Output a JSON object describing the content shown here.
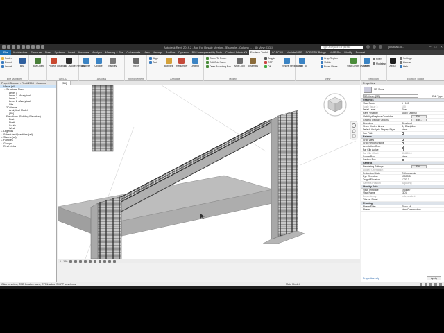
{
  "window": {
    "title": "Autodesk Revit 2019.2 - Not For Resale Version - [Example - Column ... - 3D View: {3D}]",
    "search_placeholder": "Type a keyword or phrase",
    "user": "jonathan.ho...",
    "controls": [
      "–",
      "□",
      "✕"
    ]
  },
  "ribbon_tabs": [
    {
      "label": "File"
    },
    {
      "label": "Architecture"
    },
    {
      "label": "Structure"
    },
    {
      "label": "Steel"
    },
    {
      "label": "Systems"
    },
    {
      "label": "Insert"
    },
    {
      "label": "Annotate"
    },
    {
      "label": "Analyze"
    },
    {
      "label": "Massing & Site"
    },
    {
      "label": "Collaborate"
    },
    {
      "label": "View"
    },
    {
      "label": "Manage"
    },
    {
      "label": "Add-Ins"
    },
    {
      "label": "Dynamo"
    },
    {
      "label": "BIM Interoperability Tools"
    },
    {
      "label": "Content Admin Kit"
    },
    {
      "label": "Ecotech Toolkit"
    },
    {
      "label": "AGACAD"
    },
    {
      "label": "Naviate MEP"
    },
    {
      "label": "SOFiSTiK Bridge"
    },
    {
      "label": "NMIP Pro"
    },
    {
      "label": "Modify"
    },
    {
      "label": "Precast"
    }
  ],
  "ribbon": {
    "groups": [
      {
        "title": "BIM Manager"
      },
      {
        "title": "QA/QC"
      },
      {
        "title": "Analysis"
      },
      {
        "title": "Reinforcement"
      },
      {
        "title": "Annotate"
      },
      {
        "title": "Modify"
      },
      {
        "title": "View"
      },
      {
        "title": "Selection"
      },
      {
        "title": "Ecotech Toolkit"
      }
    ],
    "buttons": {
      "folder": "Folder",
      "export": "Export",
      "import": "Import",
      "bim": "BIM",
      "bim_query": "BIM Query",
      "project_cleanup": "Project Cleanup",
      "qa_model_review": "QA - Model Review",
      "analyze": "Analyze",
      "update": "Update",
      "visibility": "Visibility",
      "rebar": "Rebar",
      "import2": "Import",
      "align": "Align",
      "text": "Text",
      "bubbles": "Bubbles",
      "renumber": "Renumber",
      "legend": "Legend",
      "room_to_room": "Room To Room",
      "edit_grid_name": "Edit Grid Name",
      "draw_bounding_box": "Draw Bounding Box",
      "multi_join": "Multi Join",
      "assembly": "Assembly",
      "toggle": "Toggle",
      "off": "OFF",
      "on": "ON",
      "resize_section_box": "Resize Section Box",
      "zoom_to": "Zoom To",
      "crop_region": "Crop Region",
      "visible": "Visible",
      "room_views": "Room Views",
      "view_depth_override": "View Depth Override",
      "select": "Select",
      "filter": "Filter",
      "modeless": "Modeless",
      "about": "About",
      "settings": "Settings",
      "license": "License",
      "help": "Help"
    }
  },
  "project_browser": {
    "title": "Project Browser - Revit 2019 - Columns",
    "items": [
      {
        "label": "Views (all)",
        "level": 0,
        "twisty": "−",
        "selected": true
      },
      {
        "label": "Structural Plans",
        "level": 1,
        "twisty": "−"
      },
      {
        "label": "Level 1",
        "level": 2,
        "twisty": ""
      },
      {
        "label": "Level 1 - Analytical",
        "level": 2,
        "twisty": ""
      },
      {
        "label": "Level 2",
        "level": 2,
        "twisty": ""
      },
      {
        "label": "Level 2 - Analytical",
        "level": 2,
        "twisty": ""
      },
      {
        "label": "Site",
        "level": 2,
        "twisty": ""
      },
      {
        "label": "3D Views",
        "level": 1,
        "twisty": "−"
      },
      {
        "label": "Analytical Model",
        "level": 2,
        "twisty": ""
      },
      {
        "label": "{3D}",
        "level": 2,
        "twisty": ""
      },
      {
        "label": "Elevations (Building Elevation)",
        "level": 1,
        "twisty": "−"
      },
      {
        "label": "East",
        "level": 2,
        "twisty": ""
      },
      {
        "label": "North",
        "level": 2,
        "twisty": ""
      },
      {
        "label": "South",
        "level": 2,
        "twisty": ""
      },
      {
        "label": "West",
        "level": 2,
        "twisty": ""
      },
      {
        "label": "Legends",
        "level": 0,
        "twisty": "+"
      },
      {
        "label": "Schedules/Quantities (all)",
        "level": 0,
        "twisty": "+"
      },
      {
        "label": "Sheets (all)",
        "level": 0,
        "twisty": "+"
      },
      {
        "label": "Families",
        "level": 0,
        "twisty": "+"
      },
      {
        "label": "Groups",
        "level": 0,
        "twisty": "+"
      },
      {
        "label": "Revit Links",
        "level": 0,
        "twisty": ""
      }
    ]
  },
  "view": {
    "tab_label": "{3D}",
    "scale": "1 : 100"
  },
  "properties": {
    "title": "Properties",
    "type_name": "3D View",
    "instance_label": "3D View: {3D}",
    "edit_type": "Edit Type",
    "rows": [
      {
        "kind": "group",
        "name": "Graphics"
      },
      {
        "kind": "row",
        "name": "View Scale",
        "value": "1 : 100"
      },
      {
        "kind": "row",
        "name": "Scale Value 1:",
        "value": "100",
        "gray": true
      },
      {
        "kind": "row",
        "name": "Detail Level",
        "value": "Fine"
      },
      {
        "kind": "row",
        "name": "Parts Visibility",
        "value": "Show Original"
      },
      {
        "kind": "row",
        "name": "Visibility/Graphics Overrides",
        "value": "",
        "button": "Edit..."
      },
      {
        "kind": "row",
        "name": "Graphic Display Options",
        "value": "",
        "button": "Edit..."
      },
      {
        "kind": "row",
        "name": "Discipline",
        "value": "Structural"
      },
      {
        "kind": "row",
        "name": "Show Hidden Lines",
        "value": "By Discipline"
      },
      {
        "kind": "row",
        "name": "Default Analysis Display Style",
        "value": "None"
      },
      {
        "kind": "row",
        "name": "Sun Path",
        "value": "",
        "check": false
      },
      {
        "kind": "group",
        "name": "Extents"
      },
      {
        "kind": "row",
        "name": "Crop View",
        "value": "",
        "check": false
      },
      {
        "kind": "row",
        "name": "Crop Region Visible",
        "value": "",
        "check": false
      },
      {
        "kind": "row",
        "name": "Annotation Crop",
        "value": "",
        "check": false
      },
      {
        "kind": "row",
        "name": "Far Clip Active",
        "value": "",
        "check": false
      },
      {
        "kind": "row",
        "name": "Far Clip Offset",
        "value": "304800.0",
        "gray": true
      },
      {
        "kind": "row",
        "name": "Scope Box",
        "value": "None"
      },
      {
        "kind": "row",
        "name": "Section Box",
        "value": "",
        "check": false
      },
      {
        "kind": "group",
        "name": "Camera"
      },
      {
        "kind": "row",
        "name": "Rendering Settings",
        "value": "",
        "button": "Edit..."
      },
      {
        "kind": "row",
        "name": "Locked Orientation",
        "value": "",
        "gray": true
      },
      {
        "kind": "row",
        "name": "Projection Mode",
        "value": "Orthographic"
      },
      {
        "kind": "row",
        "name": "Eye Elevation",
        "value": "15553.5"
      },
      {
        "kind": "row",
        "name": "Target Elevation",
        "value": "1733.3"
      },
      {
        "kind": "row",
        "name": "Camera Position",
        "value": "Adjusting",
        "gray": true
      },
      {
        "kind": "group",
        "name": "Identity Data"
      },
      {
        "kind": "row",
        "name": "View Template",
        "value": "<None>"
      },
      {
        "kind": "row",
        "name": "View Name",
        "value": "{3D}"
      },
      {
        "kind": "row",
        "name": "Dependency",
        "value": "Independent",
        "gray": true
      },
      {
        "kind": "row",
        "name": "Title on Sheet",
        "value": ""
      },
      {
        "kind": "group",
        "name": "Phasing"
      },
      {
        "kind": "row",
        "name": "Phase Filter",
        "value": "Show All"
      },
      {
        "kind": "row",
        "name": "Phase",
        "value": "New Construction"
      }
    ],
    "help_link": "Properties help",
    "apply": "Apply"
  },
  "status_bar": {
    "hint": "Click to select, TAB for alternates, CTRL adds, SHIFT unselects.",
    "main_model": "Main Model"
  },
  "colors": {
    "file_tab": "#1c6fb3",
    "title_bg": "#2b2b2b",
    "tab_bg": "#3c3c3c",
    "concrete": "#b9b9b9",
    "rebar": "#555555"
  }
}
